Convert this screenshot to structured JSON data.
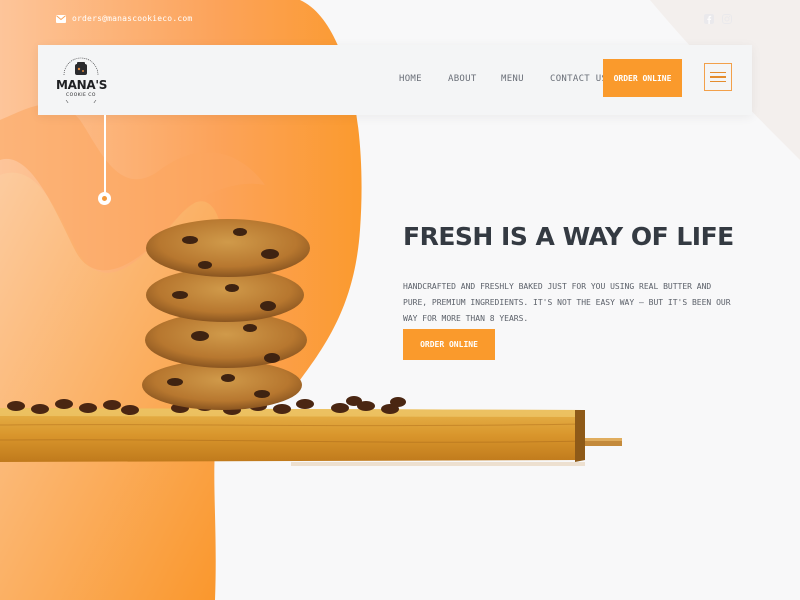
{
  "topbar": {
    "email": "orders@manascookieco.com",
    "icons": [
      "envelope-icon",
      "facebook-icon",
      "instagram-icon"
    ]
  },
  "header": {
    "logo": {
      "name": "MANA'S",
      "tagline": "COOKIE CO"
    },
    "nav": {
      "home": "HOME",
      "about": "ABOUT",
      "menu": "MENU",
      "contact": "CONTACT US"
    },
    "order_button": "ORDER ONLINE",
    "menu_icon": "hamburger-icon"
  },
  "hero": {
    "title": "FRESH IS A WAY OF LIFE",
    "description": "HANDCRAFTED AND FRESHLY BAKED JUST FOR YOU USING REAL BUTTER AND PURE, PREMIUM INGREDIENTS. IT'S NOT THE EASY WAY – BUT IT'S BEEN OUR WAY FOR MORE THAN 8 YEARS.",
    "order_button": "ORDER ONLINE"
  },
  "colors": {
    "accent": "#fa9a2c",
    "title": "#343a42",
    "background": "#f8f8f9"
  }
}
